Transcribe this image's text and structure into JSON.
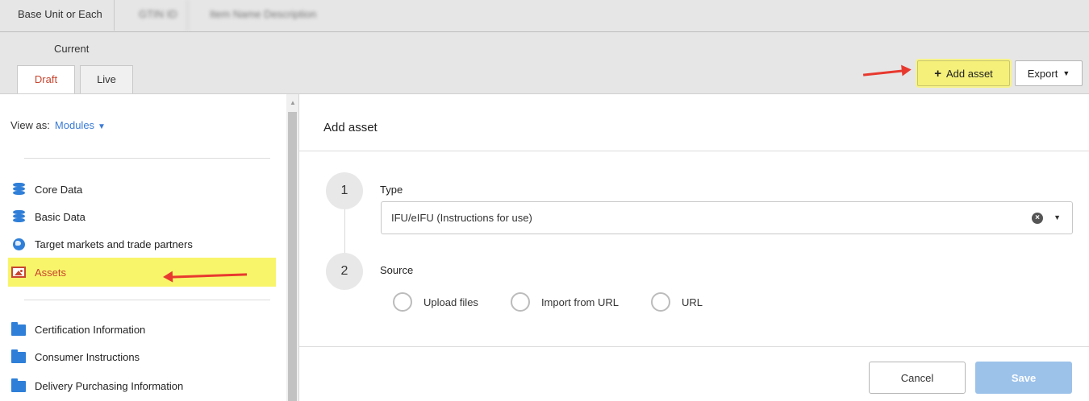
{
  "breadcrumb": {
    "items": [
      "Base Unit or Each",
      "GTIN ID",
      "Item Name Description"
    ]
  },
  "header": {
    "current_label": "Current",
    "tabs": [
      {
        "label": "Draft",
        "active": true
      },
      {
        "label": "Live",
        "active": false
      }
    ],
    "add_asset_label": "Add asset",
    "export_label": "Export"
  },
  "sidebar": {
    "view_as_label": "View as:",
    "view_as_value": "Modules",
    "items": [
      {
        "label": "Core Data",
        "icon": "database-icon"
      },
      {
        "label": "Basic Data",
        "icon": "database-icon"
      },
      {
        "label": "Target markets and trade partners",
        "icon": "globe-icon"
      },
      {
        "label": "Assets",
        "icon": "image-icon",
        "active": true
      },
      {
        "label": "Certification Information",
        "icon": "folder-icon"
      },
      {
        "label": "Consumer Instructions",
        "icon": "folder-icon"
      },
      {
        "label": "Delivery Purchasing Information",
        "icon": "folder-icon"
      }
    ]
  },
  "panel": {
    "title": "Add asset",
    "steps": [
      {
        "number": "1",
        "label": "Type"
      },
      {
        "number": "2",
        "label": "Source"
      }
    ],
    "type_value": "IFU/eIFU (Instructions for use)",
    "source_options": [
      "Upload files",
      "Import from URL",
      "URL"
    ],
    "cancel_label": "Cancel",
    "save_label": "Save"
  },
  "colors": {
    "highlight": "#f8f56b",
    "accent_blue": "#2f7fd8",
    "active_text": "#c9452f",
    "annotation_arrow": "#e8392f",
    "save_disabled": "#9cc2ea"
  }
}
